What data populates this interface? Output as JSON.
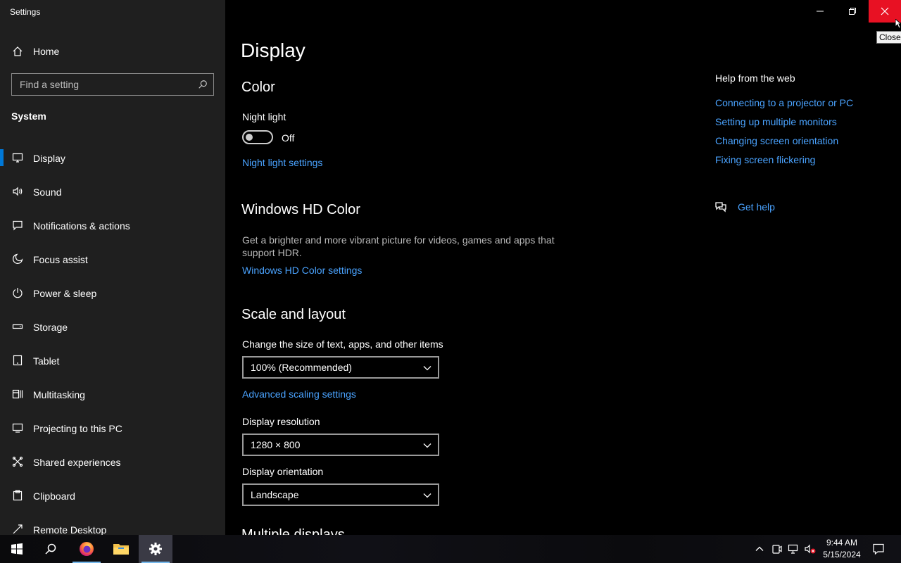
{
  "window": {
    "title": "Settings",
    "close_tooltip": "Close"
  },
  "sidebar": {
    "home_label": "Home",
    "search_placeholder": "Find a setting",
    "section": "System",
    "items": [
      {
        "label": "Display",
        "icon": "monitor-icon",
        "selected": true
      },
      {
        "label": "Sound",
        "icon": "speaker-icon"
      },
      {
        "label": "Notifications & actions",
        "icon": "notification-icon"
      },
      {
        "label": "Focus assist",
        "icon": "moon-icon"
      },
      {
        "label": "Power & sleep",
        "icon": "power-icon"
      },
      {
        "label": "Storage",
        "icon": "storage-icon"
      },
      {
        "label": "Tablet",
        "icon": "tablet-icon"
      },
      {
        "label": "Multitasking",
        "icon": "multitasking-icon"
      },
      {
        "label": "Projecting to this PC",
        "icon": "projecting-icon"
      },
      {
        "label": "Shared experiences",
        "icon": "shared-experiences-icon"
      },
      {
        "label": "Clipboard",
        "icon": "clipboard-icon"
      },
      {
        "label": "Remote Desktop",
        "icon": "remote-desktop-icon"
      }
    ]
  },
  "main": {
    "title": "Display",
    "color": {
      "heading": "Color",
      "night_light_label": "Night light",
      "night_light_state": "Off",
      "night_light_settings_link": "Night light settings"
    },
    "hd_color": {
      "heading": "Windows HD Color",
      "description": "Get a brighter and more vibrant picture for videos, games and apps that support HDR.",
      "settings_link": "Windows HD Color settings"
    },
    "scale": {
      "heading": "Scale and layout",
      "size_label": "Change the size of text, apps, and other items",
      "size_value": "100% (Recommended)",
      "advanced_link": "Advanced scaling settings",
      "resolution_label": "Display resolution",
      "resolution_value": "1280 × 800",
      "orientation_label": "Display orientation",
      "orientation_value": "Landscape",
      "next_heading": "Multiple displays"
    }
  },
  "help": {
    "heading": "Help from the web",
    "links": [
      "Connecting to a projector or PC",
      "Setting up multiple monitors",
      "Changing screen orientation",
      "Fixing screen flickering"
    ],
    "get_help": "Get help"
  },
  "taskbar": {
    "time": "9:44 AM",
    "date": "5/15/2024",
    "apps": [
      "start-icon",
      "search-icon",
      "firefox-icon",
      "file-explorer-icon",
      "settings-icon"
    ]
  },
  "colors": {
    "accent": "#0078d7",
    "link": "#4aa3ff",
    "close_hover": "#e81123"
  }
}
